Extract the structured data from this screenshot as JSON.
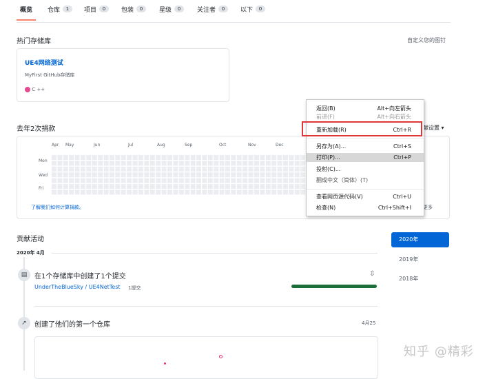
{
  "tabs": [
    {
      "label": "概览",
      "count": ""
    },
    {
      "label": "仓库",
      "count": "1"
    },
    {
      "label": "项目",
      "count": "0"
    },
    {
      "label": "包装",
      "count": "0"
    },
    {
      "label": "星级",
      "count": "0"
    },
    {
      "label": "关注者",
      "count": "0"
    },
    {
      "label": "以下",
      "count": "0"
    }
  ],
  "pinned": {
    "heading": "热门存储库",
    "customize_link": "自定义您的图钉",
    "repo_name": "UE4网络测试",
    "repo_desc": "MyFirst GitHub存储库",
    "language": "C ++",
    "language_color": "#e44b8e"
  },
  "contributions": {
    "heading": "去年2次捐款",
    "settings": "献设置",
    "months": [
      "Apr",
      "May",
      "Jun",
      "Jul",
      "Aug",
      "Sep",
      "Oct",
      "Nov",
      "Dec"
    ],
    "days": [
      "Mon",
      "Wed",
      "Fri"
    ],
    "learn_link": "了解我们如何计算捐款。",
    "more": "更多"
  },
  "activity": {
    "heading": "贡献活动",
    "period": "2020年 4月",
    "item1_text": "在1个存储库中创建了1个提交",
    "item1_repo": "UnderTheBlueSky / UE4NetTest",
    "item1_count": "1提交",
    "item2_text": "创建了他们的第一个仓库",
    "item2_date": "4月25"
  },
  "years": [
    "2020年",
    "2019年",
    "2018年"
  ],
  "context_menu": {
    "items": [
      {
        "label": "返回(B)",
        "shortcut": "Alt+向左箭头",
        "disabled": false
      },
      {
        "label": "前进(F)",
        "shortcut": "Alt+向右箭头",
        "disabled": true
      },
      {
        "label": "重新加载(R)",
        "shortcut": "Ctrl+R",
        "disabled": false
      },
      {
        "label": "另存为(A)...",
        "shortcut": "Ctrl+S",
        "disabled": false
      },
      {
        "label": "打印(P)...",
        "shortcut": "Ctrl+P",
        "disabled": false
      },
      {
        "label": "投射(C)...",
        "shortcut": "",
        "disabled": false
      },
      {
        "label": "翻成中文（简体）(T)",
        "shortcut": "",
        "disabled": false
      },
      {
        "label": "查看网页源代码(V)",
        "shortcut": "Ctrl+U",
        "disabled": false
      },
      {
        "label": "检查(N)",
        "shortcut": "Ctrl+Shift+I",
        "disabled": false
      }
    ]
  },
  "watermark": "知乎 @精彩",
  "colors": {
    "accent": "#0366d6",
    "progress": "#1b6e3a",
    "highlight_box": "#e0363a"
  }
}
